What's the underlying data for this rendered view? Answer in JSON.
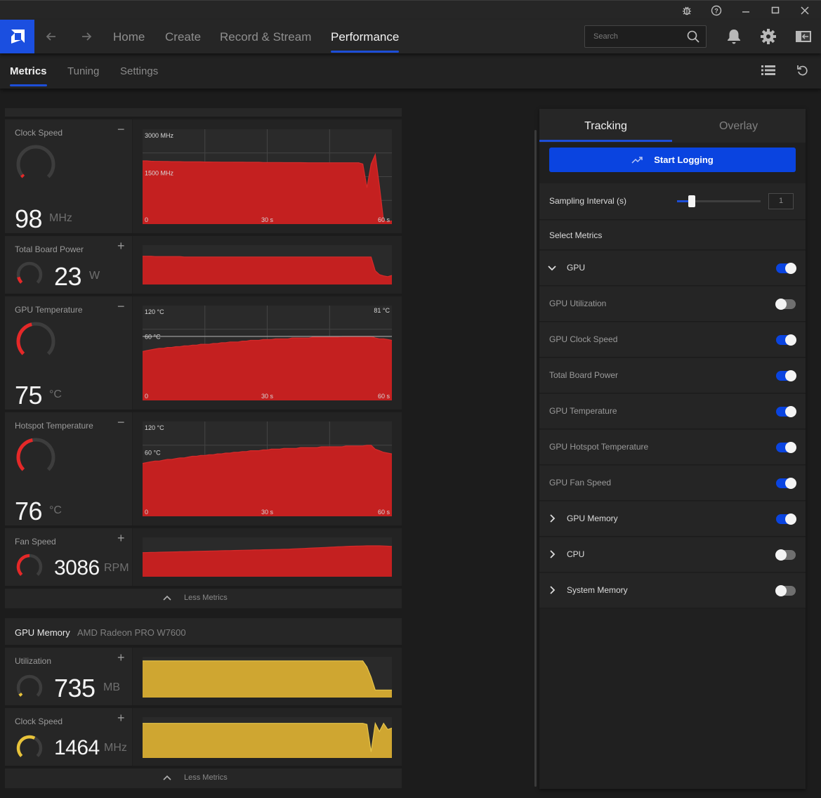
{
  "titlebar": {
    "icons": [
      "bug-report-icon",
      "help-icon",
      "minimize-icon",
      "maximize-icon",
      "close-icon"
    ]
  },
  "nav": {
    "logo": "amd-logo-icon",
    "back": "arrow-left-icon",
    "forward": "arrow-right-icon",
    "items": [
      {
        "label": "Home",
        "active": false
      },
      {
        "label": "Create",
        "active": false
      },
      {
        "label": "Record & Stream",
        "active": false
      },
      {
        "label": "Performance",
        "active": true
      }
    ],
    "search_placeholder": "Search",
    "right_icons": [
      "bell-icon",
      "gear-icon",
      "panel-collapse-icon"
    ]
  },
  "subnav": {
    "tabs": [
      {
        "label": "Metrics",
        "active": true
      },
      {
        "label": "Tuning",
        "active": false
      },
      {
        "label": "Settings",
        "active": false
      }
    ],
    "right_icons": [
      "list-view-icon",
      "reset-icon"
    ]
  },
  "colors": {
    "accent": "#1d4ed8",
    "gpu_chart": "#c42020",
    "memory_chart": "#cfa631",
    "gauge_track": "#3d3d3d"
  },
  "gpu_metrics": [
    {
      "label": "Clock Speed",
      "toggle": "−",
      "value": "98",
      "unit": "MHz",
      "gauge_fraction": 0.03,
      "expanded": true,
      "chart": {
        "y_top_label": "3000 MHz",
        "y_mid_label": "1500 MHz",
        "y_max": 3000,
        "x_labels": [
          "0",
          "30 s",
          "60 s"
        ],
        "peak_label": "",
        "values": [
          2000,
          2000,
          1990,
          1985,
          1985,
          1980,
          1980,
          1975,
          1975,
          1975,
          1970,
          1970,
          1970,
          1968,
          1968,
          1965,
          1965,
          1962,
          1962,
          1960,
          1960,
          1960,
          1958,
          1958,
          1957,
          1955,
          1955,
          1955,
          1955,
          1950,
          1950,
          1950,
          1948,
          1948,
          1945,
          1945,
          1945,
          1945,
          1945,
          1942,
          1940,
          1940,
          1940,
          1940,
          1940,
          1940,
          1940,
          1940,
          1940,
          1940,
          1940,
          1940,
          1940,
          1900,
          1150,
          1900,
          2200,
          1200,
          100,
          80,
          98
        ]
      }
    },
    {
      "label": "Total Board Power",
      "toggle": "+",
      "value": "23",
      "unit": "W",
      "gauge_fraction": 0.12,
      "expanded": false,
      "chart": {
        "y_max": 100,
        "values": [
          72,
          72,
          72,
          71,
          71,
          71,
          71,
          71,
          71,
          71,
          70,
          70,
          70,
          70,
          70,
          70,
          70,
          70,
          70,
          70,
          70,
          70,
          70,
          70,
          70,
          70,
          70,
          70,
          70,
          70,
          70,
          70,
          70,
          70,
          70,
          70,
          70,
          70,
          70,
          70,
          70,
          70,
          70,
          70,
          70,
          70,
          70,
          70,
          70,
          70,
          70,
          70,
          70,
          70,
          70,
          70,
          35,
          25,
          22,
          20,
          23
        ]
      }
    },
    {
      "label": "GPU Temperature",
      "toggle": "−",
      "value": "75",
      "unit": "°C",
      "gauge_fraction": 0.45,
      "expanded": true,
      "chart": {
        "y_top_label": "120 °C",
        "y_mid_label": "60 °C",
        "y_max": 120,
        "x_labels": [
          "0",
          "30 s",
          "60 s"
        ],
        "peak_label": "81 °C",
        "values": [
          62,
          63,
          64,
          65,
          66,
          66,
          67,
          67,
          68,
          68,
          69,
          69,
          70,
          70,
          71,
          71,
          71,
          72,
          72,
          73,
          73,
          74,
          74,
          74,
          75,
          75,
          76,
          76,
          76,
          77,
          77,
          77,
          78,
          78,
          78,
          78,
          79,
          79,
          79,
          79,
          79,
          80,
          80,
          80,
          80,
          80,
          80,
          80,
          81,
          81,
          81,
          81,
          81,
          81,
          81,
          81,
          79,
          78,
          78,
          77,
          76
        ]
      }
    },
    {
      "label": "Hotspot Temperature",
      "toggle": "−",
      "value": "76",
      "unit": "°C",
      "gauge_fraction": 0.46,
      "expanded": true,
      "chart": {
        "y_top_label": "120 °C",
        "y_mid_label": "60 °C",
        "y_max": 120,
        "x_labels": [
          "0",
          "30 s",
          "60 s"
        ],
        "peak_label": "",
        "values": [
          67,
          68,
          69,
          70,
          70,
          71,
          72,
          72,
          73,
          74,
          74,
          75,
          76,
          76,
          77,
          77,
          78,
          78,
          79,
          79,
          80,
          80,
          81,
          81,
          82,
          82,
          83,
          83,
          83,
          84,
          84,
          85,
          85,
          85,
          86,
          86,
          86,
          86,
          87,
          87,
          87,
          87,
          87,
          88,
          88,
          88,
          88,
          88,
          88,
          89,
          89,
          89,
          89,
          89,
          90,
          90,
          85,
          83,
          81,
          80,
          79
        ]
      }
    },
    {
      "label": "Fan Speed",
      "toggle": "+",
      "value": "3086",
      "unit": "RPM",
      "gauge_fraction": 0.5,
      "expanded": false,
      "chart": {
        "y_max": 4000,
        "values": [
          2450,
          2460,
          2470,
          2480,
          2490,
          2500,
          2510,
          2520,
          2530,
          2540,
          2550,
          2560,
          2570,
          2580,
          2590,
          2600,
          2610,
          2620,
          2630,
          2640,
          2650,
          2660,
          2670,
          2680,
          2690,
          2700,
          2710,
          2720,
          2730,
          2740,
          2750,
          2760,
          2770,
          2780,
          2790,
          2800,
          2820,
          2840,
          2860,
          2880,
          2900,
          2920,
          2940,
          2960,
          2980,
          3000,
          3020,
          3040,
          3060,
          3080,
          3100,
          3110,
          3120,
          3130,
          3140,
          3140,
          3140,
          3140,
          3130,
          3110,
          3086
        ]
      }
    }
  ],
  "less_metrics_label": "Less Metrics",
  "memory_section": {
    "title": "GPU Memory",
    "device": "AMD Radeon PRO W7600",
    "metrics": [
      {
        "label": "Utilization",
        "toggle": "+",
        "value": "735",
        "unit": "MB",
        "gauge_fraction": 0.05,
        "expanded": false,
        "chart": {
          "y_max": 4000,
          "values": [
            3600,
            3600,
            3600,
            3600,
            3600,
            3600,
            3600,
            3600,
            3600,
            3600,
            3600,
            3600,
            3600,
            3600,
            3600,
            3600,
            3600,
            3600,
            3600,
            3600,
            3600,
            3600,
            3600,
            3600,
            3600,
            3600,
            3600,
            3600,
            3600,
            3600,
            3600,
            3600,
            3600,
            3600,
            3600,
            3600,
            3600,
            3600,
            3600,
            3600,
            3600,
            3600,
            3600,
            3600,
            3600,
            3600,
            3600,
            3600,
            3600,
            3600,
            3600,
            3600,
            3600,
            3600,
            3000,
            2000,
            735,
            735,
            735,
            735,
            735
          ]
        }
      },
      {
        "label": "Clock Speed",
        "toggle": "+",
        "value": "1464",
        "unit": "MHz",
        "gauge_fraction": 0.6,
        "expanded": false,
        "chart": {
          "y_max": 2000,
          "values": [
            1700,
            1700,
            1700,
            1700,
            1700,
            1700,
            1700,
            1700,
            1700,
            1700,
            1700,
            1700,
            1700,
            1700,
            1700,
            1700,
            1700,
            1700,
            1700,
            1700,
            1700,
            1700,
            1700,
            1700,
            1700,
            1700,
            1700,
            1700,
            1700,
            1700,
            1700,
            1700,
            1700,
            1700,
            1700,
            1700,
            1700,
            1700,
            1700,
            1700,
            1700,
            1700,
            1700,
            1700,
            1700,
            1700,
            1700,
            1700,
            1700,
            1700,
            1700,
            1700,
            1700,
            1700,
            1650,
            300,
            1700,
            1300,
            1700,
            1400,
            1464
          ]
        }
      }
    ]
  },
  "tracking": {
    "tabs": [
      {
        "label": "Tracking",
        "active": true
      },
      {
        "label": "Overlay",
        "active": false
      }
    ],
    "start_logging_label": "Start Logging",
    "sampling_label": "Sampling Interval (s)",
    "sampling_value": "1",
    "sampling_slider_fraction": 0.18,
    "select_metrics_label": "Select Metrics",
    "rows": [
      {
        "label": "GPU",
        "type": "group",
        "expanded": true,
        "on": true
      },
      {
        "label": "GPU Utilization",
        "type": "item",
        "on": false
      },
      {
        "label": "GPU Clock Speed",
        "type": "item",
        "on": true
      },
      {
        "label": "Total Board Power",
        "type": "item",
        "on": true
      },
      {
        "label": "GPU Temperature",
        "type": "item",
        "on": true
      },
      {
        "label": "GPU Hotspot Temperature",
        "type": "item",
        "on": true
      },
      {
        "label": "GPU Fan Speed",
        "type": "item",
        "on": true
      },
      {
        "label": "GPU Memory",
        "type": "group",
        "expanded": false,
        "on": true
      },
      {
        "label": "CPU",
        "type": "group",
        "expanded": false,
        "on": false
      },
      {
        "label": "System Memory",
        "type": "group",
        "expanded": false,
        "on": false
      }
    ]
  }
}
